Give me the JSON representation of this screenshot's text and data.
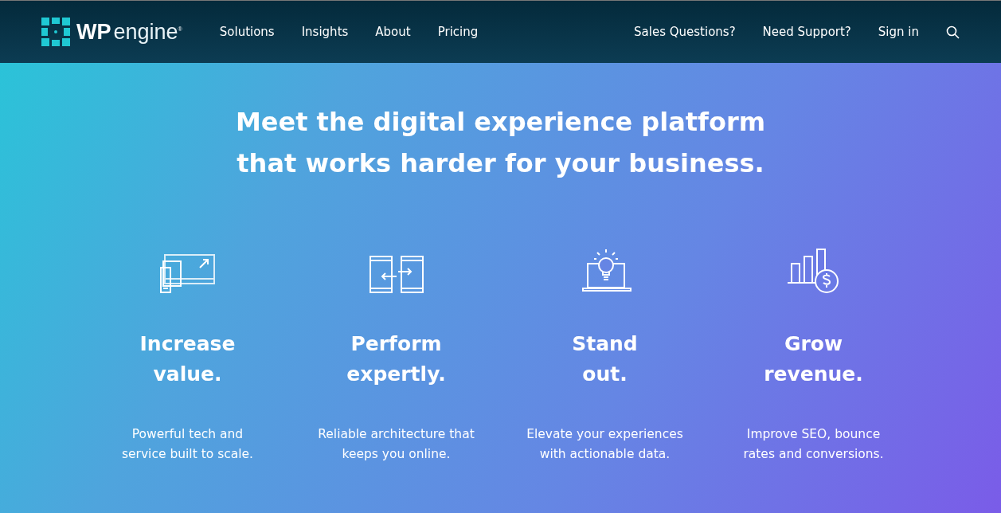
{
  "header": {
    "logo": {
      "bold": "WP",
      "light": "engine",
      "mark": "®"
    },
    "nav": [
      "Solutions",
      "Insights",
      "About",
      "Pricing"
    ],
    "utility": [
      "Sales Questions?",
      "Need Support?",
      "Sign in"
    ]
  },
  "hero": {
    "title_lines": [
      "Meet the digital experience platform",
      "that works harder for your business."
    ]
  },
  "features": [
    {
      "kind": "devices",
      "title_lines": [
        "Increase",
        "value."
      ],
      "text_lines": [
        "Powerful tech and",
        "service built to scale."
      ]
    },
    {
      "kind": "transfer",
      "title_lines": [
        "Perform",
        "expertly."
      ],
      "text_lines": [
        "Reliable architecture that",
        "keeps you online."
      ]
    },
    {
      "kind": "idea",
      "title_lines": [
        "Stand",
        "out."
      ],
      "text_lines": [
        "Elevate your experiences",
        "with actionable data."
      ]
    },
    {
      "kind": "growth",
      "title_lines": [
        "Grow",
        "revenue."
      ],
      "text_lines": [
        "Improve SEO, bounce",
        "rates and conversions."
      ]
    }
  ]
}
